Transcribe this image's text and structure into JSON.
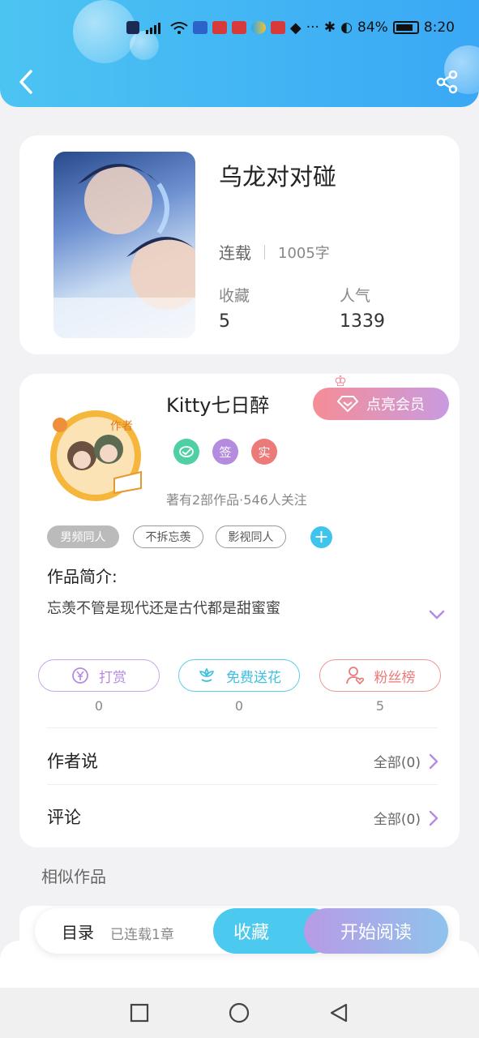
{
  "status_bar": {
    "battery": "84%",
    "time": "8:20"
  },
  "book": {
    "title": "乌龙对对碰",
    "status": "连载",
    "word_count": "1005字",
    "favorites_label": "收藏",
    "favorites_value": "5",
    "popularity_label": "人气",
    "popularity_value": "1339"
  },
  "author": {
    "avatar_badge": "作者",
    "name": "Kitty七日醉",
    "vip_button": "点亮会员",
    "badges": [
      "签",
      "实"
    ],
    "stats": "著有2部作品·546人关注"
  },
  "tags": [
    "男频同人",
    "不拆忘羡",
    "影视同人"
  ],
  "intro": {
    "label": "作品简介:",
    "text": "忘羡不管是现代还是古代都是甜蜜蜜"
  },
  "actions": [
    {
      "label": "打赏",
      "count": "0"
    },
    {
      "label": "免费送花",
      "count": "0"
    },
    {
      "label": "粉丝榜",
      "count": "5"
    }
  ],
  "rows": [
    {
      "label": "作者说",
      "right": "全部(0)"
    },
    {
      "label": "评论",
      "right": "全部(0)"
    }
  ],
  "similar_title": "相似作品",
  "bottom": {
    "toc": "目录",
    "chapters": "已连载1章",
    "favorite": "收藏",
    "read": "开始阅读"
  },
  "colors": {
    "header": "#3aa8f5",
    "accent_cyan": "#4cc9ef",
    "purple": "#b58be0",
    "coral": "#e97b78"
  }
}
